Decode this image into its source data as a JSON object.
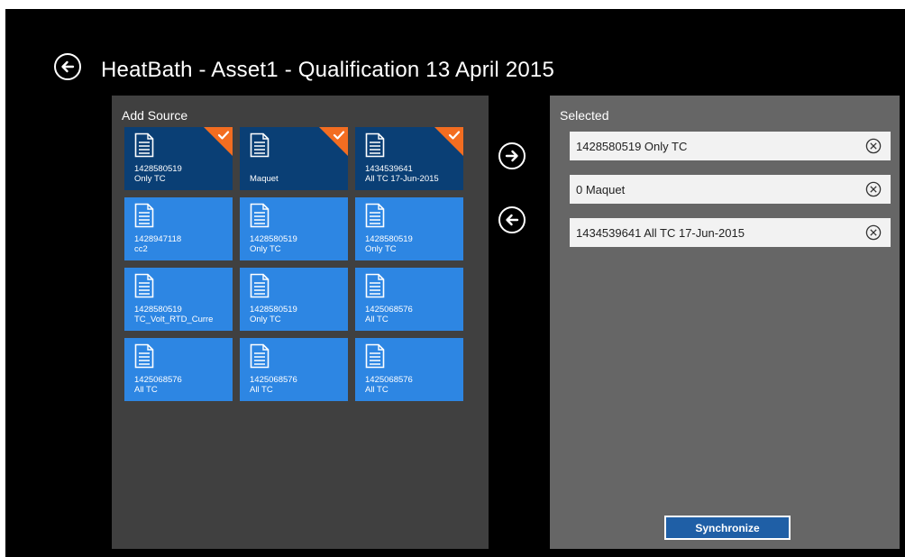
{
  "header": {
    "title": "HeatBath -  Asset1 - Qualification 13 April 2015",
    "back_icon": "arrow-left-circle-icon"
  },
  "source_panel": {
    "heading": "Add Source",
    "tiles": [
      {
        "line1": "1428580519",
        "line2": "Only TC",
        "selected": true
      },
      {
        "line1": "",
        "line2": "Maquet",
        "selected": true
      },
      {
        "line1": "1434539641",
        "line2": "All TC 17-Jun-2015",
        "selected": true
      },
      {
        "line1": "1428947118",
        "line2": "cc2",
        "selected": false
      },
      {
        "line1": "1428580519",
        "line2": "Only TC",
        "selected": false
      },
      {
        "line1": "1428580519",
        "line2": "Only TC",
        "selected": false
      },
      {
        "line1": "1428580519",
        "line2": "TC_Volt_RTD_Curre",
        "selected": false
      },
      {
        "line1": "1428580519",
        "line2": "Only TC",
        "selected": false
      },
      {
        "line1": "1425068576",
        "line2": "All TC",
        "selected": false
      },
      {
        "line1": "1425068576",
        "line2": "All TC",
        "selected": false
      },
      {
        "line1": "1425068576",
        "line2": "All TC",
        "selected": false
      },
      {
        "line1": "1425068576",
        "line2": "All TC",
        "selected": false
      }
    ]
  },
  "transfer": {
    "add_icon": "arrow-right-circle-icon",
    "remove_icon": "arrow-left-circle-icon"
  },
  "selected_panel": {
    "heading": "Selected",
    "items": [
      {
        "label": "1428580519   Only TC"
      },
      {
        "label": "0   Maquet"
      },
      {
        "label": "1434539641   All TC 17-Jun-2015"
      }
    ],
    "sync_label": "Synchronize"
  },
  "colors": {
    "background": "#000000",
    "tile": "#2d86e3",
    "tile_selected": "#0a3f75",
    "check_corner": "#f36d21",
    "source_panel": "#404040",
    "selected_panel": "#666666",
    "sync_button": "#1f5fa6"
  }
}
